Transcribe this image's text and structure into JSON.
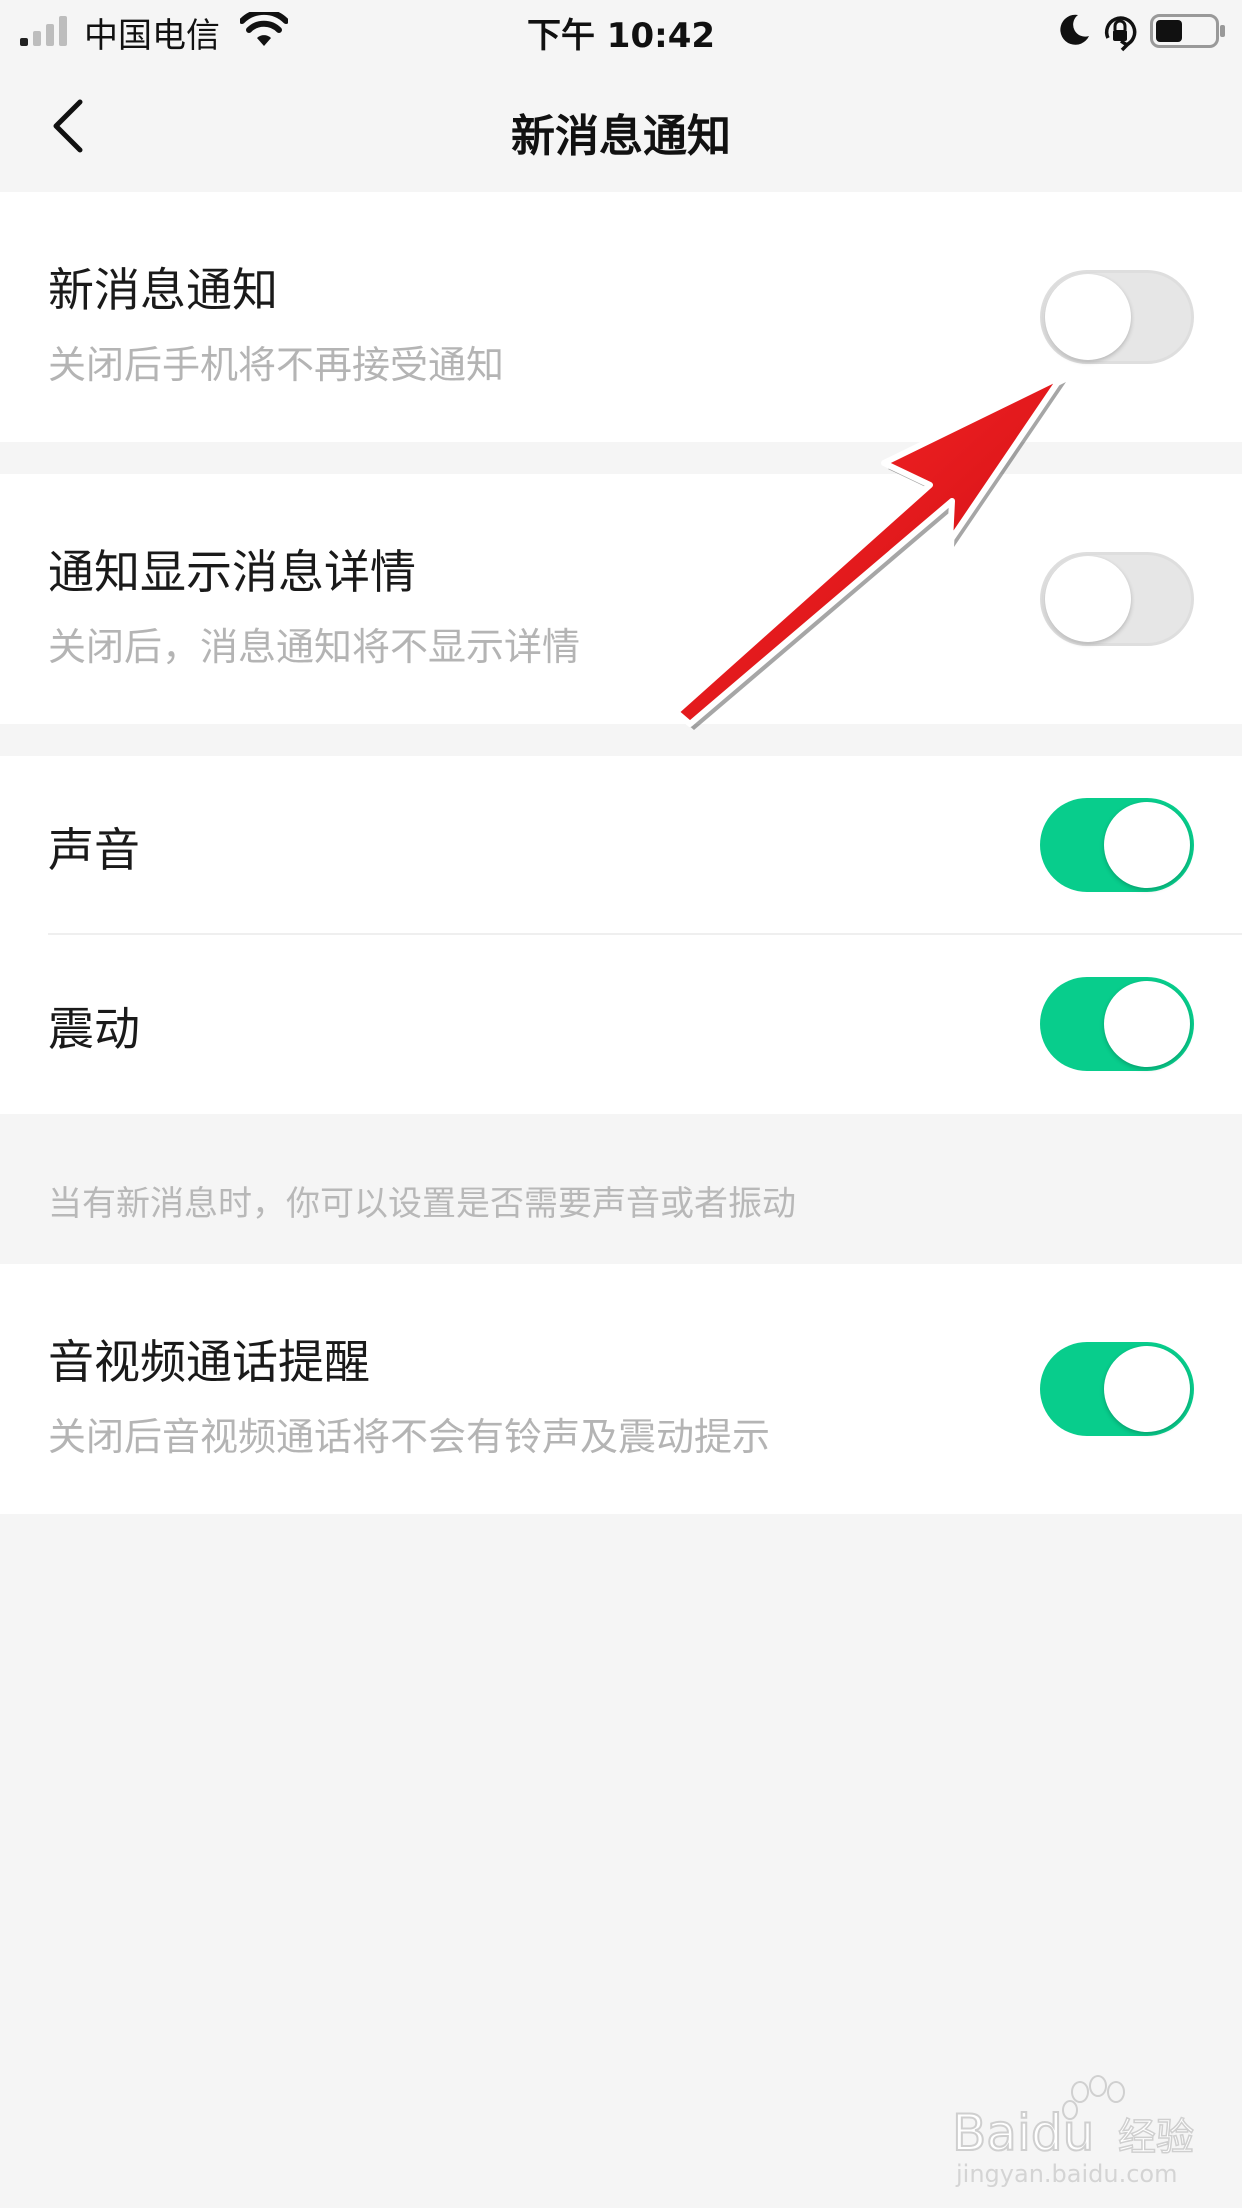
{
  "status_bar": {
    "carrier": "中国电信",
    "time": "下午 10:42"
  },
  "nav": {
    "title": "新消息通知"
  },
  "settings": [
    {
      "title": "新消息通知",
      "subtitle": "关闭后手机将不再接受通知",
      "enabled": false
    },
    {
      "title": "通知显示消息详情",
      "subtitle": "关闭后，消息通知将不显示详情",
      "enabled": false
    },
    {
      "title": "声音",
      "enabled": true
    },
    {
      "title": "震动",
      "enabled": true
    },
    {
      "title": "音视频通话提醒",
      "subtitle": "关闭后音视频通话将不会有铃声及震动提示",
      "enabled": true
    }
  ],
  "hint": "当有新消息时，你可以设置是否需要声音或者振动",
  "colors": {
    "accent_green": "#08cd8c",
    "toggle_off": "#e6e6e6",
    "annotation_arrow": "#e8141b",
    "background": "#f5f5f5"
  },
  "watermark": {
    "brand": "Baidu",
    "brand_cn": "经验",
    "url": "jingyan.baidu.com"
  }
}
